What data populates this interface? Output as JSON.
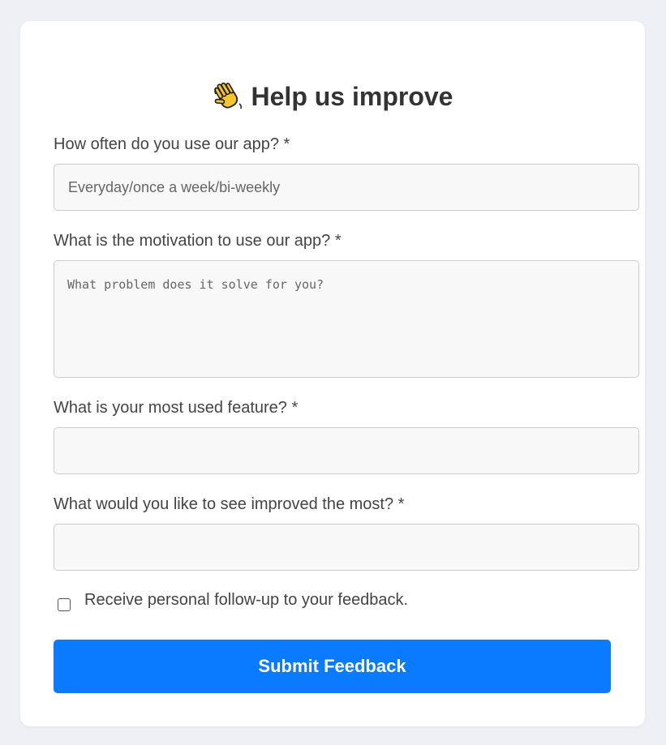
{
  "form": {
    "title": "Help us improve",
    "title_icon": "waving-hand-icon",
    "questions": [
      {
        "label": "How often do you use our app? *",
        "placeholder": "Everyday/once a week/bi-weekly",
        "value": ""
      },
      {
        "label": "What is the motivation to use our app? *",
        "placeholder": "What problem does it solve for you?",
        "value": ""
      },
      {
        "label": "What is your most used feature? *",
        "placeholder": "",
        "value": ""
      },
      {
        "label": "What would you like to see improved the most? *",
        "placeholder": "",
        "value": ""
      }
    ],
    "followup_label": "Receive personal follow-up to your feedback.",
    "followup_checked": false,
    "submit_label": "Submit Feedback"
  },
  "colors": {
    "background": "#eef0f5",
    "card": "#ffffff",
    "primary": "#0a7bff",
    "field_bg": "#f8f8f8",
    "field_border": "#cccccc"
  }
}
